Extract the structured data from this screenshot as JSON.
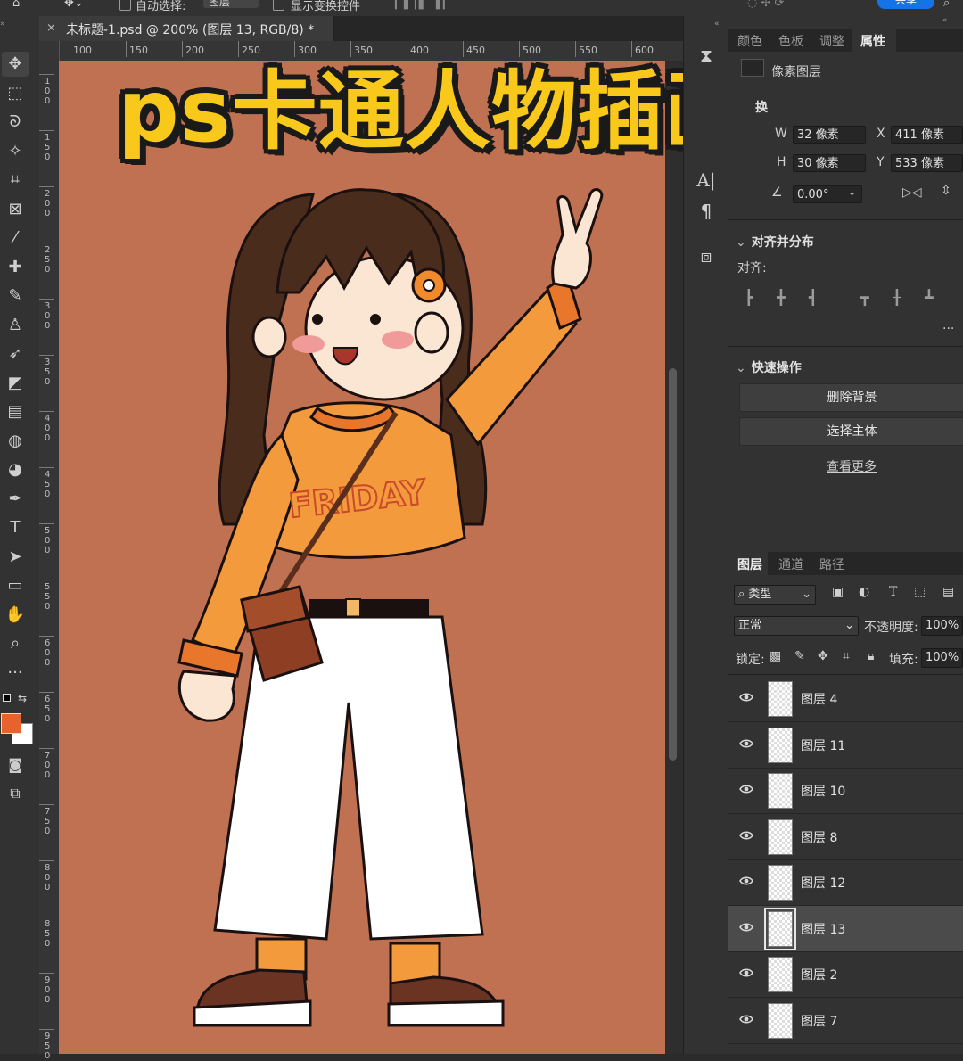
{
  "options_bar": {
    "auto_select_label": "自动选择:",
    "auto_select_value": "图层",
    "show_transform_label": "显示变换控件",
    "share_label": "共享"
  },
  "tools": [
    {
      "name": "move-tool-icon",
      "glyph": "✥"
    },
    {
      "name": "marquee-tool-icon",
      "glyph": "⬚"
    },
    {
      "name": "lasso-tool-icon",
      "glyph": "ᘐ"
    },
    {
      "name": "magic-wand-icon",
      "glyph": "✧"
    },
    {
      "name": "crop-tool-icon",
      "glyph": "⌗"
    },
    {
      "name": "frame-tool-icon",
      "glyph": "⊠"
    },
    {
      "name": "eyedropper-icon",
      "glyph": "⁄"
    },
    {
      "name": "healing-brush-icon",
      "glyph": "✚"
    },
    {
      "name": "brush-tool-icon",
      "glyph": "✎"
    },
    {
      "name": "clone-stamp-icon",
      "glyph": "♙"
    },
    {
      "name": "history-brush-icon",
      "glyph": "➶"
    },
    {
      "name": "eraser-tool-icon",
      "glyph": "◩"
    },
    {
      "name": "gradient-tool-icon",
      "glyph": "▤"
    },
    {
      "name": "blur-tool-icon",
      "glyph": "◍"
    },
    {
      "name": "dodge-tool-icon",
      "glyph": "◕"
    },
    {
      "name": "pen-tool-icon",
      "glyph": "✒"
    },
    {
      "name": "type-tool-icon",
      "glyph": "T"
    },
    {
      "name": "path-selection-icon",
      "glyph": "➤"
    },
    {
      "name": "rectangle-tool-icon",
      "glyph": "▭"
    },
    {
      "name": "hand-tool-icon",
      "glyph": "✋"
    },
    {
      "name": "zoom-tool-icon",
      "glyph": "⌕"
    },
    {
      "name": "more-tools-icon",
      "glyph": "···"
    }
  ],
  "colors": {
    "foreground": "#e8622e",
    "background": "#ffffff",
    "canvas_bg": "#c07152",
    "accent": "#1473e6",
    "title_yellow": "#f8c81a"
  },
  "document": {
    "tab_title": "未标题-1.psd @ 200% (图层 13, RGB/8) *",
    "close_glyph": "×"
  },
  "ruler": {
    "h_ticks": [
      "100",
      "150",
      "200",
      "250",
      "300",
      "350",
      "400",
      "450",
      "500",
      "550",
      "600"
    ],
    "v_ticks": [
      "100",
      "150",
      "200",
      "250",
      "300",
      "350",
      "400",
      "450",
      "500",
      "550",
      "600",
      "650",
      "700",
      "750",
      "800",
      "850",
      "900",
      "950"
    ]
  },
  "overlay_title": "ps卡通人物插画",
  "artwork": {
    "shirt_text": "FRIDAY"
  },
  "properties_panel": {
    "tabs": [
      "颜色",
      "色板",
      "调整",
      "属性"
    ],
    "active_tab": "属性",
    "layer_type": "像素图层",
    "transform_label": "换",
    "w_label": "W",
    "w_value": "32 像素",
    "h_label": "H",
    "h_value": "30 像素",
    "x_label": "X",
    "x_value": "411 像素",
    "y_label": "Y",
    "y_value": "533 像素",
    "angle_value": "0.00°",
    "align_section": "对齐并分布",
    "align_label": "对齐:",
    "quick_section": "快速操作",
    "remove_bg": "删除背景",
    "select_subject": "选择主体",
    "see_more": "查看更多",
    "more_glyph": "···"
  },
  "layers_panel": {
    "tabs": [
      "图层",
      "通道",
      "路径"
    ],
    "active_tab": "图层",
    "filter_label": "类型",
    "blend_mode": "正常",
    "opacity_label": "不透明度:",
    "opacity_value": "100%",
    "lock_label": "锁定:",
    "fill_label": "填充:",
    "fill_value": "100%",
    "layers": [
      {
        "name": "图层 4",
        "selected": false
      },
      {
        "name": "图层 11",
        "selected": false
      },
      {
        "name": "图层 10",
        "selected": false
      },
      {
        "name": "图层 8",
        "selected": false
      },
      {
        "name": "图层 12",
        "selected": false
      },
      {
        "name": "图层 13",
        "selected": true
      },
      {
        "name": "图层 2",
        "selected": false
      },
      {
        "name": "图层 7",
        "selected": false
      }
    ]
  }
}
